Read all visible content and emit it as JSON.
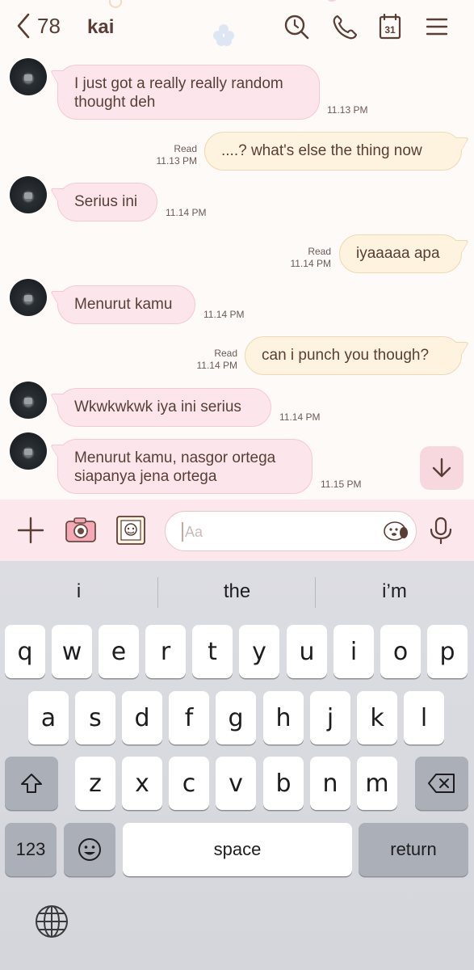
{
  "header": {
    "back_count": "78",
    "contact_name": "kai",
    "icons": [
      "search-icon",
      "phone-icon",
      "calendar-icon",
      "menu-icon"
    ],
    "calendar_day": "31"
  },
  "messages": [
    {
      "side": "in",
      "text": "I just got a really really random thought deh",
      "time": "11.13 PM"
    },
    {
      "side": "out",
      "text": "....? what's else the thing now",
      "status": "Read",
      "time": "11.13 PM"
    },
    {
      "side": "in",
      "text": "Serius ini",
      "time": "11.14 PM"
    },
    {
      "side": "out",
      "text": "iyaaaaa apa",
      "status": "Read",
      "time": "11.14 PM"
    },
    {
      "side": "in",
      "text": "Menurut kamu",
      "time": "11.14 PM"
    },
    {
      "side": "out",
      "text": "can i punch you though?",
      "status": "Read",
      "time": "11.14 PM"
    },
    {
      "side": "in",
      "text": "Wkwkwkwk iya ini serius",
      "time": "11.14 PM"
    },
    {
      "side": "in",
      "text": "Menurut kamu, nasgor ortega siapanya jena ortega",
      "time": "11.15 PM"
    }
  ],
  "message_lines": {
    "m0": [
      "I just got a really really random",
      "thought deh"
    ],
    "m7": [
      "Menurut kamu, nasgor ortega",
      "siapanya jena ortega"
    ]
  },
  "input": {
    "placeholder": "Aa"
  },
  "keyboard": {
    "suggestions": [
      "i",
      "the",
      "i’m"
    ],
    "row1": [
      "q",
      "w",
      "e",
      "r",
      "t",
      "y",
      "u",
      "i",
      "o",
      "p"
    ],
    "row2": [
      "a",
      "s",
      "d",
      "f",
      "g",
      "h",
      "j",
      "k",
      "l"
    ],
    "row3": [
      "z",
      "x",
      "c",
      "v",
      "b",
      "n",
      "m"
    ],
    "numbers_label": "123",
    "space_label": "space",
    "return_label": "return"
  },
  "colors": {
    "incoming_bubble": "#fce6ec",
    "outgoing_bubble": "#fdf3df",
    "text": "#5a3e36",
    "input_bar": "#fbe7ec"
  }
}
